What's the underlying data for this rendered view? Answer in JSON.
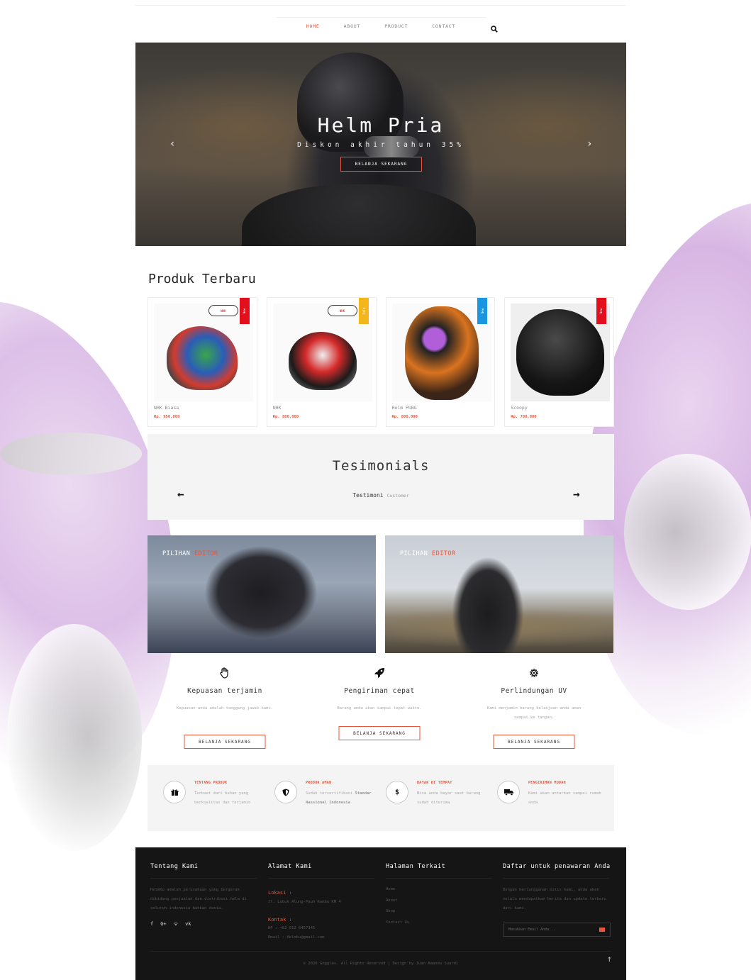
{
  "nav": {
    "items": [
      "HOME",
      "ABOUT",
      "PRODUCT",
      "CONTACT"
    ],
    "active_index": 0
  },
  "hero": {
    "title": "Helm Pria",
    "subtitle": "Diskon akhir tahun 35%",
    "button": "BELANJA SEKARANG"
  },
  "products": {
    "title": "Produk Terbaru",
    "items": [
      {
        "name": "NHK Biasa",
        "price": "Rp. 950,000",
        "badge": "New",
        "badge_color": "#e1101c"
      },
      {
        "name": "NHK",
        "price": "Rp. 800,000",
        "badge": "Sale",
        "badge_color": "#f3b71b"
      },
      {
        "name": "Helm PUBG",
        "price": "Rp. 800,000",
        "badge": "New",
        "badge_color": "#1a96e0"
      },
      {
        "name": "Scoopy",
        "price": "Rp. 700,000",
        "badge": "New",
        "badge_color": "#e1101c"
      }
    ]
  },
  "testimonials": {
    "title": "Tesimonials",
    "text": "Testimoni",
    "text_small": "Customer"
  },
  "editor": {
    "label_a": "PILIHAN",
    "label_b": "EDITOR"
  },
  "features": [
    {
      "icon": "hand-icon",
      "title": "Kepuasan terjamin",
      "text": "Kepuasan anda adalah tanggung jawab kami.",
      "button": "BELANJA SEKARANG"
    },
    {
      "icon": "rocket-icon",
      "title": "Pengiriman cepat",
      "text": "Barang anda akan sampai tepat waktu.",
      "button": "BELANJA SEKARANG"
    },
    {
      "icon": "gear-icon",
      "title": "Perlindungan UV",
      "text": "Kami menjamin barang belanjaan anda aman sampai ke tangan.",
      "button": "BELANJA SEKARANG"
    }
  ],
  "strip": [
    {
      "icon": "gift-icon",
      "glyph": "🎁",
      "title": "TENTANG PRODUK",
      "text": "Terbuat dari bahan yang berkualitas dan terjamin"
    },
    {
      "icon": "shield-icon",
      "glyph": "⛉",
      "title": "PRODUK AMAN",
      "text": "Sudah tersertifikasi",
      "text_strong": "Standar Nassional Indonesia"
    },
    {
      "icon": "dollar-icon",
      "glyph": "$",
      "title": "BAYAR DI TEMPAT",
      "text": "Bisa anda bayar saat barang sudah diterima"
    },
    {
      "icon": "truck-icon",
      "glyph": "⛟",
      "title": "PENGIRIMAN MUDAH",
      "text": "Kami akan antarkan sampai rumah anda"
    }
  ],
  "footer": {
    "about": {
      "title": "Tentang Kami",
      "text": "HelmKu adalah perusahaan yang bergerak dibidang penjualan dan distribusi helm di seluruh indonesia bahkan dunia."
    },
    "address": {
      "title": "Alamat Kami",
      "loc_label": "Lokasi :",
      "loc_text": "Jl. Lubuk Alung-Pauh Kambu KM 4",
      "contact_label": "Kontak :",
      "phone": "HP : +62 812 6457345",
      "email": "Email : Helmku@gmail.com"
    },
    "links": {
      "title": "Halaman Terkait",
      "items": [
        "Home",
        "About",
        "Shop",
        "Contact Us"
      ]
    },
    "newsletter": {
      "title": "Daftar untuk penawaran Anda",
      "text": "Dengan berlangganan milis kami, anda akan selalu mendapatkan berita dan update terbaru dari kami.",
      "placeholder": "Masukkan Email Anda..."
    },
    "copyright": "© 2020 Goggles. All Rights Reserved | Design by Juan Amanda Suardi"
  },
  "colors": {
    "accent": "#e8563a",
    "footer_bg": "#151515",
    "panel_bg": "#f4f4f4"
  }
}
